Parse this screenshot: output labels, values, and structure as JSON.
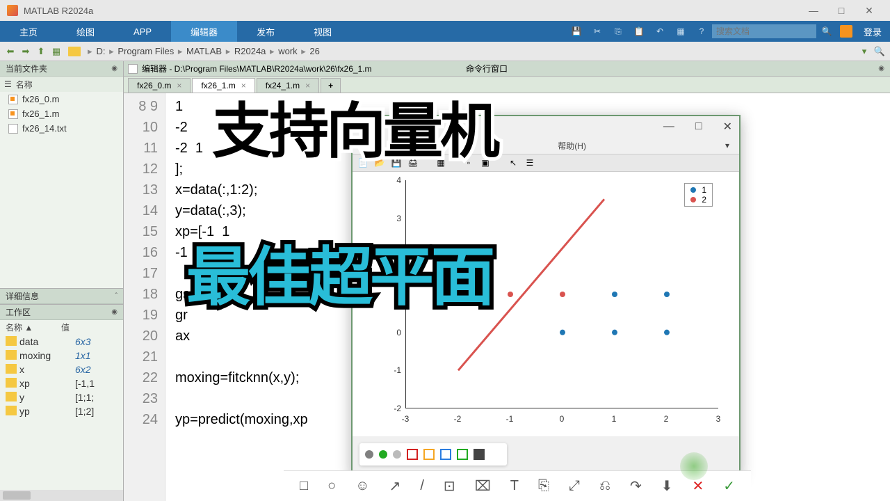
{
  "title": "MATLAB R2024a",
  "win_controls": {
    "min": "—",
    "max": "□",
    "close": "✕"
  },
  "menubar": {
    "tabs": [
      "主页",
      "绘图",
      "APP",
      "编辑器",
      "发布",
      "视图"
    ],
    "active": 3,
    "search_placeholder": "搜索文档",
    "login": "登录"
  },
  "breadcrumb": [
    "D:",
    "Program Files",
    "MATLAB",
    "R2024a",
    "work",
    "26"
  ],
  "panels": {
    "current_folder": "当前文件夹",
    "name_col": "名称",
    "files": [
      {
        "name": "fx26_0.m",
        "type": "m"
      },
      {
        "name": "fx26_1.m",
        "type": "m"
      },
      {
        "name": "fx26_14.txt",
        "type": "txt"
      }
    ],
    "details": "详细信息",
    "workspace": "工作区",
    "ws_cols": {
      "name": "名称 ▲",
      "value": "值"
    },
    "ws_vars": [
      {
        "name": "data",
        "value": "6x3",
        "italic": true
      },
      {
        "name": "moxing",
        "value": "1x1",
        "italic": true
      },
      {
        "name": "x",
        "value": "6x2",
        "italic": true
      },
      {
        "name": "xp",
        "value": "[-1,1",
        "italic": false
      },
      {
        "name": "y",
        "value": "[1;1;",
        "italic": false
      },
      {
        "name": "yp",
        "value": "[1;2]",
        "italic": false
      }
    ]
  },
  "editor": {
    "header": "编辑器 - D:\\Program Files\\MATLAB\\R2024a\\work\\26\\fx26_1.m",
    "tabs": [
      {
        "label": "fx26_0.m",
        "active": false
      },
      {
        "label": "fx26_1.m",
        "active": true
      },
      {
        "label": "fx24_1.m",
        "active": false
      }
    ],
    "line_start": 8,
    "line_end": 24,
    "lines": [
      "1",
      "-2",
      "-2  1",
      "];",
      "x=data(:,1:2);",
      "y=data(:,3);",
      "xp=[-1  1",
      "-1",
      "",
      "gs",
      "gr",
      "ax",
      "",
      "moxing=fitcknn(x,y);",
      "",
      "yp=predict(moxing,xp",
      ""
    ]
  },
  "cmdwin": "命令行窗口",
  "figure": {
    "help_menu": "帮助(H)",
    "legend": [
      "1",
      "2"
    ],
    "colors": {
      "c1": "#1f77b4",
      "c2": "#d9534f"
    }
  },
  "chart_data": {
    "type": "scatter",
    "xlim": [
      -3,
      3
    ],
    "ylim": [
      -2,
      4
    ],
    "xticks": [
      -3,
      -2,
      -1,
      0,
      1,
      2,
      3
    ],
    "yticks": [
      -2,
      -1,
      0,
      1,
      2,
      3,
      4
    ],
    "series": [
      {
        "name": "1",
        "color": "#1f77b4",
        "points": [
          [
            0,
            0
          ],
          [
            1,
            0
          ],
          [
            1,
            1
          ],
          [
            2,
            1
          ],
          [
            2,
            0
          ]
        ]
      },
      {
        "name": "2",
        "color": "#d9534f",
        "points": [
          [
            -1,
            1
          ],
          [
            0,
            1
          ]
        ]
      }
    ],
    "line": {
      "color": "#d9534f",
      "points": [
        [
          -2,
          -1
        ],
        [
          0.8,
          3.5
        ]
      ]
    }
  },
  "palette": [
    "#808080",
    "#22aa22",
    "#bbbbbb",
    "#d32222",
    "#f5a623",
    "#2b7de0",
    "#22aa22",
    "#444444",
    "#ffffff"
  ],
  "overlay": {
    "l1": "支持向量机",
    "l2": "最佳超平面"
  },
  "anno": [
    "□",
    "○",
    "☺",
    "↗",
    "/",
    "⊡",
    "⌧",
    "T",
    "⎘",
    "⤢",
    "⎌",
    "↷",
    "⬇",
    "✕",
    "✓"
  ]
}
